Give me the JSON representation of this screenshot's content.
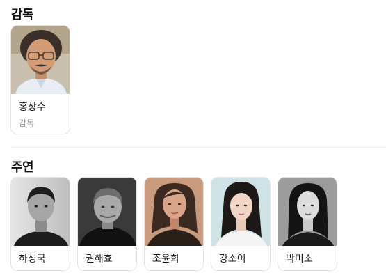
{
  "director_section": {
    "title": "감독",
    "people": [
      {
        "name": "홍상수",
        "role": "감독",
        "photo": "director-portrait"
      }
    ]
  },
  "cast_section": {
    "title": "주연",
    "people": [
      {
        "name": "하성국",
        "photo": "actor-portrait-bw"
      },
      {
        "name": "권해효",
        "photo": "actor-portrait-bw"
      },
      {
        "name": "조윤희",
        "photo": "actress-portrait-warm"
      },
      {
        "name": "강소이",
        "photo": "actress-portrait-light"
      },
      {
        "name": "박미소",
        "photo": "actress-portrait-bw"
      }
    ]
  },
  "colors": {
    "card_border": "#e4e4e4",
    "divider": "#ececec",
    "role_text": "#9a9a9a"
  }
}
